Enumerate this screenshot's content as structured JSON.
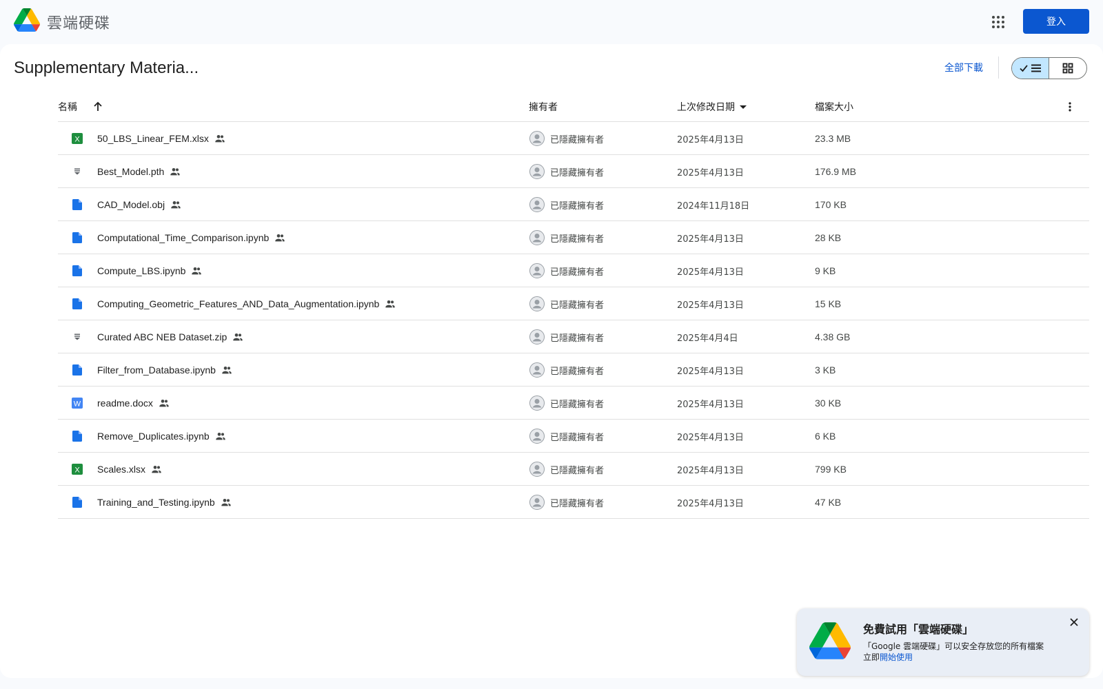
{
  "header": {
    "app_name": "雲端硬碟",
    "signin_label": "登入"
  },
  "folder": {
    "title": "Supplementary Materia...",
    "download_all_label": "全部下載"
  },
  "table": {
    "columns": {
      "name": "名稱",
      "owner": "擁有者",
      "modified": "上次修改日期",
      "size": "檔案大小"
    },
    "rows": [
      {
        "icon": "excel-icon",
        "name": "50_LBS_Linear_FEM.xlsx",
        "owner": "已隱藏擁有者",
        "modified": "2025年4月13日",
        "size": "23.3 MB"
      },
      {
        "icon": "file-generic-icon",
        "name": "Best_Model.pth",
        "owner": "已隱藏擁有者",
        "modified": "2025年4月13日",
        "size": "176.9 MB"
      },
      {
        "icon": "document-icon",
        "name": "CAD_Model.obj",
        "owner": "已隱藏擁有者",
        "modified": "2024年11月18日",
        "size": "170 KB"
      },
      {
        "icon": "document-icon",
        "name": "Computational_Time_Comparison.ipynb",
        "owner": "已隱藏擁有者",
        "modified": "2025年4月13日",
        "size": "28 KB"
      },
      {
        "icon": "document-icon",
        "name": "Compute_LBS.ipynb",
        "owner": "已隱藏擁有者",
        "modified": "2025年4月13日",
        "size": "9 KB"
      },
      {
        "icon": "document-icon",
        "name": "Computing_Geometric_Features_AND_Data_Augmentation.ipynb",
        "owner": "已隱藏擁有者",
        "modified": "2025年4月13日",
        "size": "15 KB"
      },
      {
        "icon": "file-generic-icon",
        "name": "Curated ABC NEB Dataset.zip",
        "owner": "已隱藏擁有者",
        "modified": "2025年4月4日",
        "size": "4.38 GB"
      },
      {
        "icon": "document-icon",
        "name": "Filter_from_Database.ipynb",
        "owner": "已隱藏擁有者",
        "modified": "2025年4月13日",
        "size": "3 KB"
      },
      {
        "icon": "word-icon",
        "name": "readme.docx",
        "owner": "已隱藏擁有者",
        "modified": "2025年4月13日",
        "size": "30 KB"
      },
      {
        "icon": "document-icon",
        "name": "Remove_Duplicates.ipynb",
        "owner": "已隱藏擁有者",
        "modified": "2025年4月13日",
        "size": "6 KB"
      },
      {
        "icon": "excel-icon",
        "name": "Scales.xlsx",
        "owner": "已隱藏擁有者",
        "modified": "2025年4月13日",
        "size": "799 KB"
      },
      {
        "icon": "document-icon",
        "name": "Training_and_Testing.ipynb",
        "owner": "已隱藏擁有者",
        "modified": "2025年4月13日",
        "size": "47 KB"
      }
    ]
  },
  "promo": {
    "title": "免費試用「雲端硬碟」",
    "description": "「Google 雲端硬碟」可以安全存放您的所有檔案",
    "cta_prefix": "立即",
    "cta_link": "開始使用"
  },
  "colors": {
    "primary": "#0b57d0",
    "toggle_active": "#c2e7ff",
    "excel": "#1e8e3e",
    "doc": "#1a73e8",
    "word": "#4285f4"
  }
}
